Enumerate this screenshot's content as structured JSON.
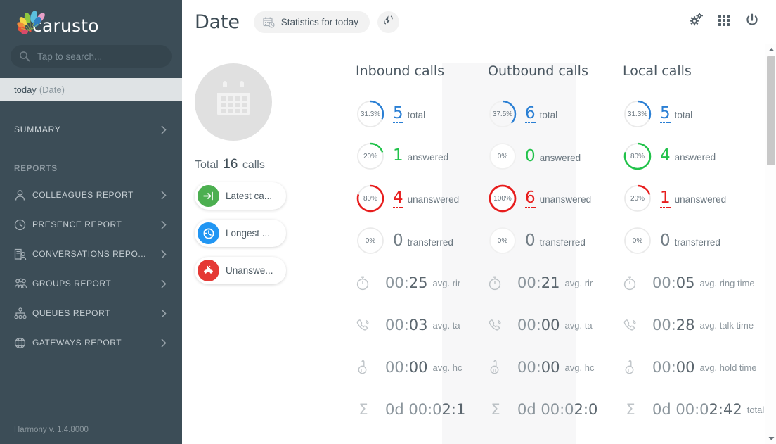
{
  "brand": {
    "name": "carusto",
    "version": "Harmony v. 1.4.8000"
  },
  "sidebar": {
    "search": {
      "placeholder": "Tap to search...",
      "value": ""
    },
    "selected": {
      "label": "today",
      "sub": "(Date)"
    },
    "summary": {
      "label": "SUMMARY"
    },
    "reports_header": "REPORTS",
    "items": [
      {
        "label": "COLLEAGUES REPORT",
        "icon": "user-icon"
      },
      {
        "label": "PRESENCE REPORT",
        "icon": "clock-icon"
      },
      {
        "label": "CONVERSATIONS REPO...",
        "icon": "conversation-icon"
      },
      {
        "label": "GROUPS REPORT",
        "icon": "group-icon"
      },
      {
        "label": "QUEUES REPORT",
        "icon": "queue-icon"
      },
      {
        "label": "GATEWAYS REPORT",
        "icon": "globe-icon"
      }
    ]
  },
  "topbar": {
    "title": "Date",
    "pill_label": "Statistics for today",
    "refresh_icon": "lightning-icon",
    "settings_icon": "gear-icon",
    "apps_icon": "grid-icon",
    "power_icon": "power-icon"
  },
  "overview": {
    "total_prefix": "Total",
    "total_value": "16",
    "total_suffix": "calls",
    "quick_buttons": [
      {
        "label": "Latest ca...",
        "color": "#4caf50",
        "icon": "arrow-into-icon"
      },
      {
        "label": "Longest ...",
        "color": "#2196f3",
        "icon": "history-icon"
      },
      {
        "label": "Unanswe...",
        "color": "#e53935",
        "icon": "missed-call-icon"
      }
    ]
  },
  "colors": {
    "blue": "#2a7fd4",
    "green": "#21c24a",
    "red": "#e71d1d",
    "track": "#eaeaea",
    "muted": "#6b7780"
  },
  "chart_data": {
    "type": "bar",
    "title": "Call statistics for today",
    "categories": [
      "Inbound calls",
      "Outbound calls",
      "Local calls"
    ],
    "series": [
      {
        "name": "total",
        "values": [
          5,
          6,
          5
        ],
        "percents": [
          "31.3%",
          "37.5%",
          "31.3%"
        ],
        "fractions": [
          0.313,
          0.375,
          0.313
        ],
        "color": "#2a7fd4"
      },
      {
        "name": "answered",
        "values": [
          1,
          0,
          4
        ],
        "percents": [
          "20%",
          "0%",
          "80%"
        ],
        "fractions": [
          0.2,
          0.0,
          0.8
        ],
        "color": "#21c24a"
      },
      {
        "name": "unanswered",
        "values": [
          4,
          6,
          1
        ],
        "percents": [
          "80%",
          "100%",
          "20%"
        ],
        "fractions": [
          0.8,
          1.0,
          0.2
        ],
        "color": "#e71d1d"
      },
      {
        "name": "transferred",
        "values": [
          0,
          0,
          0
        ],
        "percents": [
          "0%",
          "0%",
          "0%"
        ],
        "fractions": [
          0.0,
          0.0,
          0.0
        ],
        "color": "#9aa4ab"
      }
    ],
    "times": [
      {
        "name": "avg. ring time",
        "values": [
          "00:25",
          "00:21",
          "00:05"
        ]
      },
      {
        "name": "avg. talk time",
        "values": [
          "00:03",
          "00:00",
          "00:28"
        ]
      },
      {
        "name": "avg. hold time",
        "values": [
          "00:00",
          "00:00",
          "00:00"
        ]
      },
      {
        "name": "total",
        "values": [
          "0d 00:02:1",
          "0d 00:02:0",
          "0d 00:02:42"
        ]
      }
    ],
    "total_calls": 16
  },
  "columns": [
    {
      "title": "Inbound calls",
      "stats": [
        {
          "percent": "31.3%",
          "value": "5",
          "label": "total",
          "color": "#2a7fd4",
          "frac": 0.313,
          "dashed": true
        },
        {
          "percent": "20%",
          "value": "1",
          "label": "answered",
          "color": "#21c24a",
          "frac": 0.2,
          "dashed": true
        },
        {
          "percent": "80%",
          "value": "4",
          "label": "unanswered",
          "color": "#e71d1d",
          "frac": 0.8,
          "dashed": true
        },
        {
          "percent": "0%",
          "value": "0",
          "label": "transferred",
          "color": "#9aa4ab",
          "frac": 0.0,
          "dashed": false
        }
      ],
      "times": [
        {
          "icon": "stopwatch-icon",
          "a": "00:",
          "b": "25",
          "label": "avg. rir"
        },
        {
          "icon": "phone-ring-icon",
          "a": "00:",
          "b": "03",
          "label": "avg. ta"
        },
        {
          "icon": "hold-hand-icon",
          "a": "00:",
          "b": "00",
          "label": "avg. hc"
        },
        {
          "icon": "sigma-icon",
          "a": "0d 00:0",
          "b": "2:1",
          "label": ""
        }
      ]
    },
    {
      "title": "Outbound calls",
      "stats": [
        {
          "percent": "37.5%",
          "value": "6",
          "label": "total",
          "color": "#2a7fd4",
          "frac": 0.375,
          "dashed": true
        },
        {
          "percent": "0%",
          "value": "0",
          "label": "answered",
          "color": "#21c24a",
          "frac": 0.0,
          "dashed": false
        },
        {
          "percent": "100%",
          "value": "6",
          "label": "unanswered",
          "color": "#e71d1d",
          "frac": 1.0,
          "dashed": true
        },
        {
          "percent": "0%",
          "value": "0",
          "label": "transferred",
          "color": "#9aa4ab",
          "frac": 0.0,
          "dashed": false
        }
      ],
      "times": [
        {
          "icon": "stopwatch-icon",
          "a": "00:",
          "b": "21",
          "label": "avg. rir"
        },
        {
          "icon": "phone-ring-icon",
          "a": "00:",
          "b": "00",
          "label": "avg. ta"
        },
        {
          "icon": "hold-hand-icon",
          "a": "00:",
          "b": "00",
          "label": "avg. hc"
        },
        {
          "icon": "sigma-icon",
          "a": "0d 00:0",
          "b": "2:0",
          "label": ""
        }
      ]
    },
    {
      "title": "Local calls",
      "stats": [
        {
          "percent": "31.3%",
          "value": "5",
          "label": "total",
          "color": "#2a7fd4",
          "frac": 0.313,
          "dashed": true
        },
        {
          "percent": "80%",
          "value": "4",
          "label": "answered",
          "color": "#21c24a",
          "frac": 0.8,
          "dashed": true
        },
        {
          "percent": "20%",
          "value": "1",
          "label": "unanswered",
          "color": "#e71d1d",
          "frac": 0.2,
          "dashed": true
        },
        {
          "percent": "0%",
          "value": "0",
          "label": "transferred",
          "color": "#9aa4ab",
          "frac": 0.0,
          "dashed": false
        }
      ],
      "times": [
        {
          "icon": "stopwatch-icon",
          "a": "00:",
          "b": "05",
          "label": "avg. ring time"
        },
        {
          "icon": "phone-ring-icon",
          "a": "00:",
          "b": "28",
          "label": "avg. talk time"
        },
        {
          "icon": "hold-hand-icon",
          "a": "00:",
          "b": "00",
          "label": "avg. hold time"
        },
        {
          "icon": "sigma-icon",
          "a": "0d 00:0",
          "b": "2:42",
          "label": "total"
        }
      ]
    }
  ]
}
